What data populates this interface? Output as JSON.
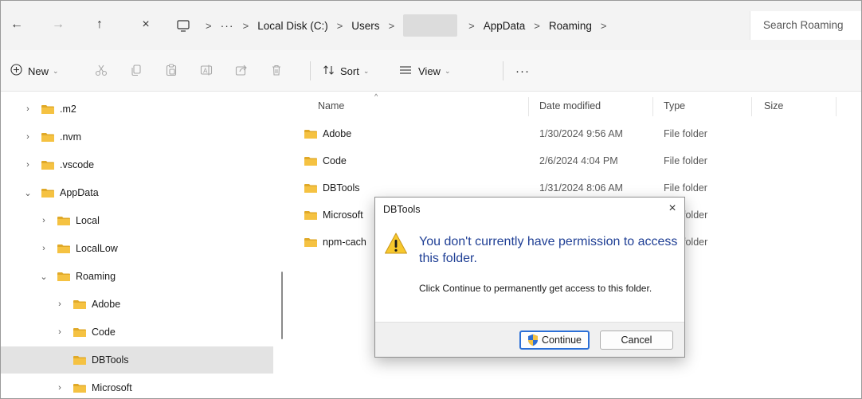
{
  "nav": {
    "back_icon": "←",
    "forward_icon": "→",
    "up_icon": "↑",
    "close_icon": "×"
  },
  "breadcrumb": {
    "overflow": "···",
    "separator": ">",
    "items": [
      "Local Disk (C:)",
      "Users",
      "",
      "AppData",
      "Roaming"
    ]
  },
  "search": {
    "placeholder": "Search Roaming"
  },
  "toolbar": {
    "new_label": "New",
    "sort_label": "Sort",
    "view_label": "View",
    "more_label": "···"
  },
  "sidebar": {
    "items": [
      {
        "label": ".m2",
        "chevron": "›",
        "expanded": false,
        "selected": false
      },
      {
        "label": ".nvm",
        "chevron": "›",
        "expanded": false,
        "selected": false
      },
      {
        "label": ".vscode",
        "chevron": "›",
        "expanded": false,
        "selected": false
      },
      {
        "label": "AppData",
        "chevron": "⌄",
        "expanded": true,
        "selected": false
      },
      {
        "label": "Local",
        "chevron": "›",
        "expanded": false,
        "selected": false
      },
      {
        "label": "LocalLow",
        "chevron": "›",
        "expanded": false,
        "selected": false
      },
      {
        "label": "Roaming",
        "chevron": "⌄",
        "expanded": true,
        "selected": false
      },
      {
        "label": "Adobe",
        "chevron": "›",
        "expanded": false,
        "selected": false
      },
      {
        "label": "Code",
        "chevron": "›",
        "expanded": false,
        "selected": false
      },
      {
        "label": "DBTools",
        "chevron": "",
        "expanded": false,
        "selected": true
      },
      {
        "label": "Microsoft",
        "chevron": "›",
        "expanded": false,
        "selected": false
      }
    ]
  },
  "file_list": {
    "columns": [
      "Name",
      "Date modified",
      "Type",
      "Size"
    ],
    "rows": [
      {
        "name": "Adobe",
        "date": "1/30/2024 9:56 AM",
        "type": "File folder",
        "size": ""
      },
      {
        "name": "Code",
        "date": "2/6/2024 4:04 PM",
        "type": "File folder",
        "size": ""
      },
      {
        "name": "DBTools",
        "date": "1/31/2024 8:06 AM",
        "type": "File folder",
        "size": ""
      },
      {
        "name": "Microsoft",
        "date": "",
        "type": "folder",
        "size": ""
      },
      {
        "name": "npm-cach",
        "date": "",
        "type": "folder",
        "size": ""
      }
    ]
  },
  "dialog": {
    "title": "DBTools",
    "close_icon": "×",
    "main_text": "You don't currently have permission to access this folder.",
    "sub_text": "Click Continue to permanently get access to this folder.",
    "continue_label": "Continue",
    "cancel_label": "Cancel"
  },
  "colors": {
    "folder": "#f5c242",
    "folder_dark": "#e0a928",
    "dialog_heading": "#1f3f95",
    "selected_bg": "#e3e3e3",
    "primary_border": "#2b6fd6"
  }
}
